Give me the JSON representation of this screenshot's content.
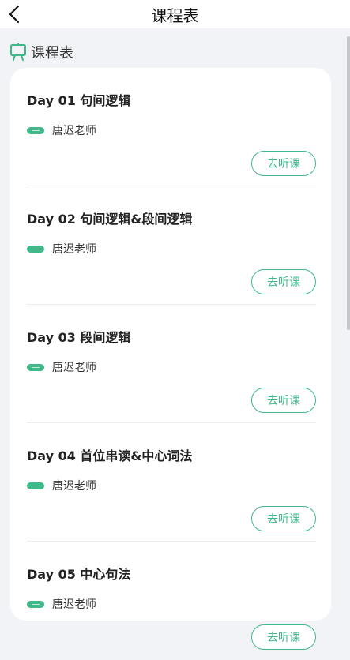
{
  "nav": {
    "title": "课程表"
  },
  "section": {
    "title": "课程表"
  },
  "colors": {
    "accent": "#3fb88a",
    "page_bg": "#f2f3f6",
    "card_bg": "#ffffff"
  },
  "lessons": [
    {
      "title": "Day 01 句间逻辑",
      "teacher": "唐迟老师",
      "button": "去听课",
      "badge_icon": "video-badge-icon"
    },
    {
      "title": "Day 02 句间逻辑&段间逻辑",
      "teacher": "唐迟老师",
      "button": "去听课",
      "badge_icon": "video-badge-icon"
    },
    {
      "title": "Day 03 段间逻辑",
      "teacher": "唐迟老师",
      "button": "去听课",
      "badge_icon": "video-badge-icon"
    },
    {
      "title": "Day 04 首位串读&中心词法",
      "teacher": "唐迟老师",
      "button": "去听课",
      "badge_icon": "video-badge-icon"
    },
    {
      "title": "Day 05 中心句法",
      "teacher": "唐迟老师",
      "button": "去听课",
      "badge_icon": "video-badge-icon"
    }
  ]
}
